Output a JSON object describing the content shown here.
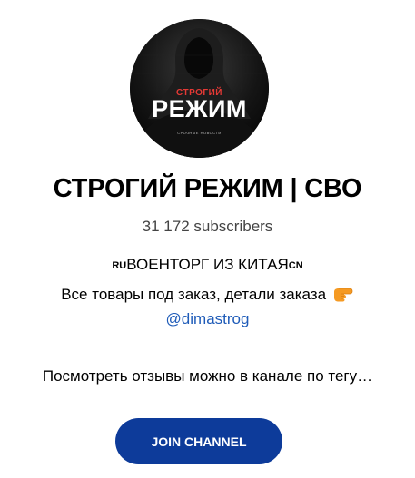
{
  "avatar": {
    "top_word": "СТРОГИЙ",
    "main_word": "РЕЖИМ",
    "tagline": "СРОЧНЫЕ НОВОСТИ"
  },
  "channel": {
    "title": "СТРОГИЙ РЕЖИМ | СВО",
    "subscribers": "31 172 subscribers"
  },
  "description": {
    "line1_prefix": "RU",
    "line1_text": "ВОЕНТОРГ ИЗ КИТАЯ",
    "line1_suffix": "CN",
    "line2_text": "Все товары под заказ, детали заказа",
    "line2_icon": "pointing-hand-icon",
    "mention": "@dimastrog",
    "line4_text": "Посмотреть отзывы можно в канале по тегу…"
  },
  "join_button": {
    "label": "JOIN CHANNEL",
    "color": "#0d3b9a"
  },
  "colors": {
    "link": "#1e5bb8",
    "subscribers": "#444444",
    "avatar_accent": "#e53935"
  }
}
